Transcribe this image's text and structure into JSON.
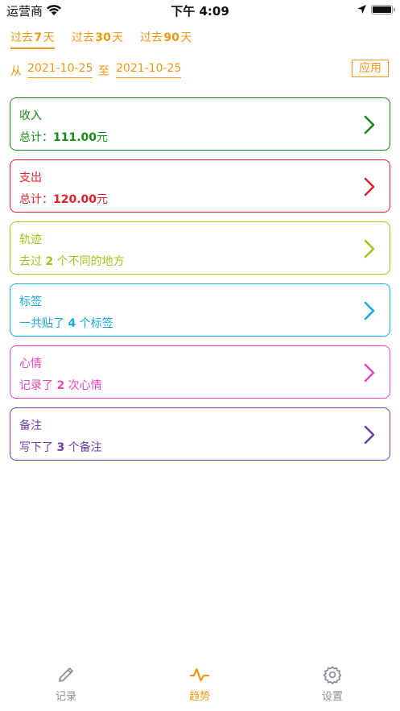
{
  "status_bar": {
    "carrier": "运营商",
    "time": "下午 4:09"
  },
  "range_tabs": [
    {
      "prefix": "过去",
      "num": "7",
      "suffix": "天",
      "active": true
    },
    {
      "prefix": "过去",
      "num": "30",
      "suffix": "天",
      "active": false
    },
    {
      "prefix": "过去",
      "num": "90",
      "suffix": "天",
      "active": false
    }
  ],
  "date_filter": {
    "from_word": "从",
    "from_date": "2021-10-25",
    "to_word": "至",
    "to_date": "2021-10-25",
    "apply_label": "应用"
  },
  "cards": [
    {
      "title": "收入",
      "pre": "总计：",
      "num": "111.00",
      "post": "元",
      "color": "#178a17"
    },
    {
      "title": "支出",
      "pre": "总计：",
      "num": "120.00",
      "post": "元",
      "color": "#e8202a"
    },
    {
      "title": "轨迹",
      "pre": "去过 ",
      "num": "2",
      "post": " 个不同的地方",
      "color": "#a8c01a"
    },
    {
      "title": "标签",
      "pre": "一共贴了 ",
      "num": "4",
      "post": " 个标签",
      "color": "#1aaae0"
    },
    {
      "title": "心情",
      "pre": "记录了 ",
      "num": "2",
      "post": " 次心情",
      "color": "#e845b8"
    },
    {
      "title": "备注",
      "pre": "写下了 ",
      "num": "3",
      "post": " 个备注",
      "color": "#6b3fa8"
    }
  ],
  "tab_bar": {
    "items": [
      {
        "label": "记录",
        "icon": "pencil-icon",
        "active": false
      },
      {
        "label": "趋势",
        "icon": "trend-wave-icon",
        "active": true
      },
      {
        "label": "设置",
        "icon": "gear-icon",
        "active": false
      }
    ],
    "active_color": "#f19712",
    "inactive_color": "#8a8f9a"
  },
  "accent_color": "#f19712"
}
